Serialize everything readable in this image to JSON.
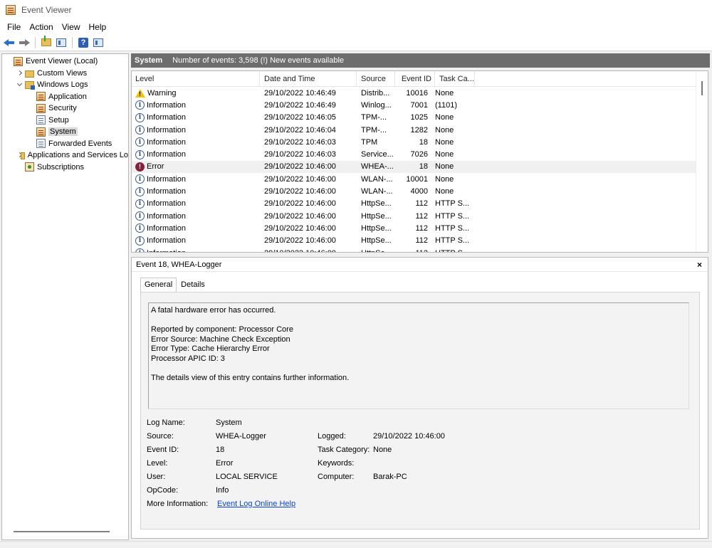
{
  "window": {
    "title": "Event Viewer"
  },
  "menu": [
    "File",
    "Action",
    "View",
    "Help"
  ],
  "tree": {
    "items": [
      {
        "label": "Event Viewer (Local)",
        "indent": 0,
        "exp": "none",
        "icon": "log-warn"
      },
      {
        "label": "Custom Views",
        "indent": 1,
        "exp": "right",
        "icon": "folder"
      },
      {
        "label": "Windows Logs",
        "indent": 1,
        "exp": "down",
        "icon": "folder-blue"
      },
      {
        "label": "Application",
        "indent": 2,
        "exp": "none",
        "icon": "log-warn"
      },
      {
        "label": "Security",
        "indent": 2,
        "exp": "none",
        "icon": "log-warn"
      },
      {
        "label": "Setup",
        "indent": 2,
        "exp": "none",
        "icon": "log"
      },
      {
        "label": "System",
        "indent": 2,
        "exp": "none",
        "icon": "log-warn",
        "selected": true
      },
      {
        "label": "Forwarded Events",
        "indent": 2,
        "exp": "none",
        "icon": "log"
      },
      {
        "label": "Applications and Services Lo",
        "indent": 1,
        "exp": "right",
        "icon": "folder"
      },
      {
        "label": "Subscriptions",
        "indent": 1,
        "exp": "none",
        "icon": "subs"
      }
    ]
  },
  "header": {
    "title": "System",
    "info": "Number of events: 3,598 (!) New events available"
  },
  "grid": {
    "columns": [
      "Level",
      "Date and Time",
      "Source",
      "Event ID",
      "Task Ca..."
    ],
    "rows": [
      {
        "level": "Warning",
        "type": "warn",
        "date": "29/10/2022 10:46:49",
        "source": "Distrib...",
        "id": "10016",
        "task": "None"
      },
      {
        "level": "Information",
        "type": "info",
        "date": "29/10/2022 10:46:49",
        "source": "Winlog...",
        "id": "7001",
        "task": "(1101)"
      },
      {
        "level": "Information",
        "type": "info",
        "date": "29/10/2022 10:46:05",
        "source": "TPM-...",
        "id": "1025",
        "task": "None"
      },
      {
        "level": "Information",
        "type": "info",
        "date": "29/10/2022 10:46:04",
        "source": "TPM-...",
        "id": "1282",
        "task": "None"
      },
      {
        "level": "Information",
        "type": "info",
        "date": "29/10/2022 10:46:03",
        "source": "TPM",
        "id": "18",
        "task": "None"
      },
      {
        "level": "Information",
        "type": "info",
        "date": "29/10/2022 10:46:03",
        "source": "Service...",
        "id": "7026",
        "task": "None"
      },
      {
        "level": "Error",
        "type": "error",
        "date": "29/10/2022 10:46:00",
        "source": "WHEA-...",
        "id": "18",
        "task": "None",
        "selected": true
      },
      {
        "level": "Information",
        "type": "info",
        "date": "29/10/2022 10:46:00",
        "source": "WLAN-...",
        "id": "10001",
        "task": "None"
      },
      {
        "level": "Information",
        "type": "info",
        "date": "29/10/2022 10:46:00",
        "source": "WLAN-...",
        "id": "4000",
        "task": "None"
      },
      {
        "level": "Information",
        "type": "info",
        "date": "29/10/2022 10:46:00",
        "source": "HttpSe...",
        "id": "112",
        "task": "HTTP S..."
      },
      {
        "level": "Information",
        "type": "info",
        "date": "29/10/2022 10:46:00",
        "source": "HttpSe...",
        "id": "112",
        "task": "HTTP S..."
      },
      {
        "level": "Information",
        "type": "info",
        "date": "29/10/2022 10:46:00",
        "source": "HttpSe...",
        "id": "112",
        "task": "HTTP S..."
      },
      {
        "level": "Information",
        "type": "info",
        "date": "29/10/2022 10:46:00",
        "source": "HttpSe...",
        "id": "112",
        "task": "HTTP S..."
      },
      {
        "level": "Information",
        "type": "info",
        "date": "29/10/2022 10:46:00",
        "source": "HttpSe...",
        "id": "112",
        "task": "HTTP S..."
      }
    ]
  },
  "detail": {
    "title": "Event 18, WHEA-Logger",
    "close": "×",
    "tabs": [
      "General",
      "Details"
    ],
    "description": "A fatal hardware error has occurred.\n\nReported by component: Processor Core\nError Source: Machine Check Exception\nError Type: Cache Hierarchy Error\nProcessor APIC ID: 3\n\nThe details view of this entry contains further information.",
    "props": {
      "log_name": {
        "label": "Log Name:",
        "value": "System"
      },
      "source": {
        "label": "Source:",
        "value": "WHEA-Logger"
      },
      "logged": {
        "label": "Logged:",
        "value": "29/10/2022 10:46:00"
      },
      "event_id": {
        "label": "Event ID:",
        "value": "18"
      },
      "task_category": {
        "label": "Task Category:",
        "value": "None"
      },
      "level": {
        "label": "Level:",
        "value": "Error"
      },
      "keywords": {
        "label": "Keywords:",
        "value": ""
      },
      "user": {
        "label": "User:",
        "value": "LOCAL SERVICE"
      },
      "computer": {
        "label": "Computer:",
        "value": "Barak-PC"
      },
      "opcode": {
        "label": "OpCode:",
        "value": "Info"
      },
      "more_info": {
        "label": "More Information:",
        "value": "Event Log Online Help"
      }
    }
  }
}
